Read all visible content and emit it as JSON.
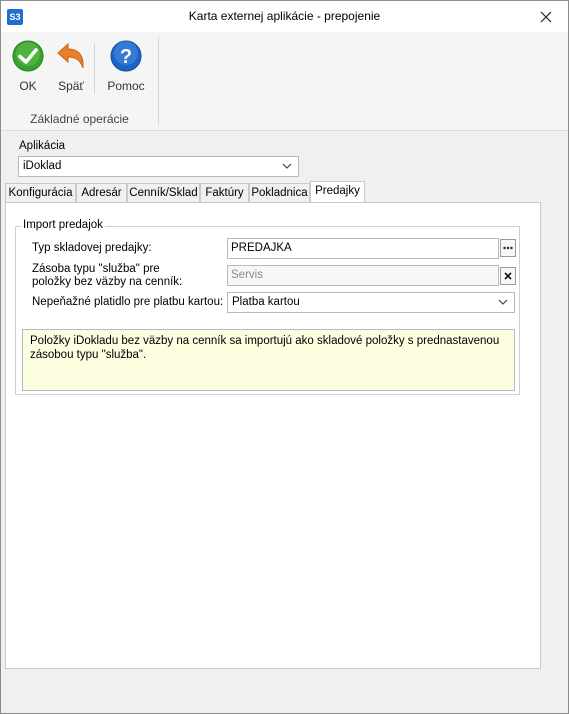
{
  "window": {
    "title": "Karta externej aplikácie - prepojenie",
    "app_icon_text": "S3"
  },
  "ribbon": {
    "buttons": [
      {
        "label": "OK",
        "icon": "check-circle-icon"
      },
      {
        "label": "Späť",
        "icon": "undo-arrow-icon"
      },
      {
        "label": "Pomoc",
        "icon": "help-icon"
      }
    ],
    "group_label": "Základné operácie"
  },
  "app_field": {
    "label": "Aplikácia",
    "value": "iDoklad"
  },
  "tabs": [
    "Konfigurácia",
    "Adresár",
    "Cenník/Sklad",
    "Faktúry",
    "Pokladnica",
    "Predajky"
  ],
  "active_tab": "Predajky",
  "section": {
    "legend": "Import predajok",
    "fields": [
      {
        "label": "Typ skladovej predajky:",
        "value": "PREDAJKA"
      },
      {
        "label_line1": "Zásoba typu \"služba\" pre",
        "label_line2": "položky bez väzby na cenník:",
        "placeholder": "Servis"
      },
      {
        "label": "Nepeňažné platidlo pre platbu kartou:",
        "value": "Platba kartou"
      }
    ],
    "note": "Položky iDokladu bez väzby na cenník sa importujú ako skladové položky s prednastavenou zásobou typu \"služba\"."
  },
  "colors": {
    "ok_green": "#3aa12e",
    "back_orange": "#e8812a",
    "help_blue": "#1e63c6",
    "note_bg": "#fdfde0"
  }
}
